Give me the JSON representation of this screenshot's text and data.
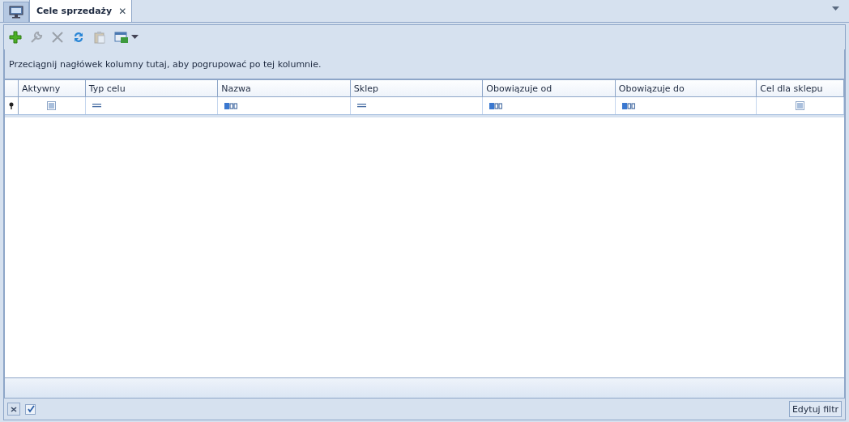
{
  "tabs": [
    {
      "kind": "icon",
      "selected": false
    },
    {
      "kind": "text",
      "label": "Cele sprzedaży",
      "close": "✕",
      "selected": true
    }
  ],
  "toolbar": [
    {
      "kind": "add",
      "disabled": false
    },
    {
      "kind": "edit",
      "disabled": true
    },
    {
      "kind": "delete",
      "disabled": true
    },
    {
      "kind": "refresh",
      "disabled": false
    },
    {
      "kind": "paste",
      "disabled": true
    },
    {
      "kind": "export",
      "disabled": false
    }
  ],
  "group_panel": {
    "text": "Przeciągnij nagłówek kolumny tutaj, aby pogrupować po tej kolumnie."
  },
  "table": {
    "columns": [
      {
        "label": "Aktywny",
        "filter": {
          "kind": "checkbox",
          "checked": false
        }
      },
      {
        "label": "Typ celu",
        "filter": {
          "kind": "equals"
        }
      },
      {
        "label": "Nazwa",
        "filter": {
          "kind": "text"
        }
      },
      {
        "label": "Sklep",
        "filter": {
          "kind": "equals"
        }
      },
      {
        "label": "Obowiązuje od",
        "filter": {
          "kind": "text"
        }
      },
      {
        "label": "Obowiązuje do",
        "filter": {
          "kind": "text"
        }
      },
      {
        "label": "Cel dla sklepu",
        "filter": {
          "kind": "checkbox",
          "checked": false
        }
      }
    ]
  },
  "footer": {
    "filter_enabled": true,
    "edit_filter": "Edytuj filtr"
  }
}
